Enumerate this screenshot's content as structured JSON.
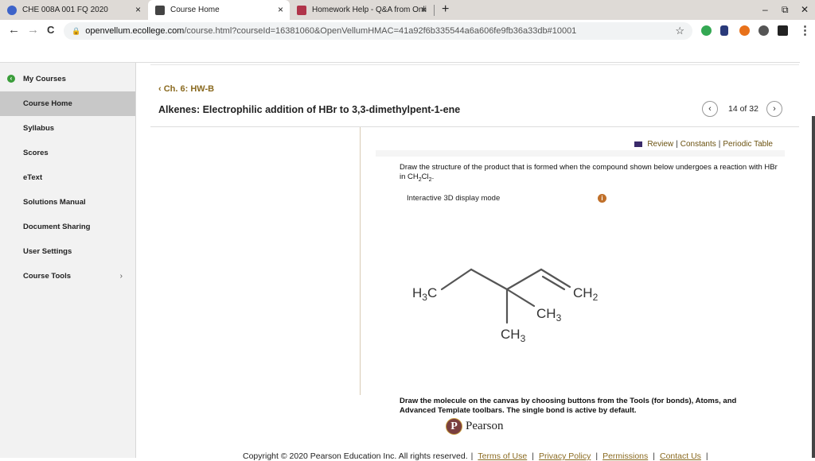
{
  "browser": {
    "tabs": [
      {
        "title": "CHE 008A 001 FQ 2020",
        "active": false,
        "icon": "course-logo-icon"
      },
      {
        "title": "Course Home",
        "active": true,
        "icon": "page-icon"
      },
      {
        "title": "Homework Help - Q&A from Onli",
        "active": false,
        "icon": "chegg-icon"
      }
    ],
    "new_tab": "+",
    "close_glyph": "×",
    "window_controls": {
      "minimize": "–",
      "restore": "⧉",
      "close": "✕"
    },
    "nav": {
      "back": "←",
      "forward": "→",
      "reload": "C"
    },
    "url_host": "openvellum.ecollege.com",
    "url_path": "/course.html?courseId=16381060&OpenVellumHMAC=41a92f6b335544a6a606fe9fb36a33db#10001",
    "star": "☆",
    "menu": "⋮",
    "extension_colors": [
      "#34a853",
      "#2a3a7a",
      "#e8711a",
      "#444444",
      "#222222"
    ]
  },
  "sidebar": {
    "items": [
      {
        "label": "My Courses",
        "back_icon": "‹"
      },
      {
        "label": "Course Home",
        "active": true
      },
      {
        "label": "Syllabus"
      },
      {
        "label": "Scores"
      },
      {
        "label": "eText"
      },
      {
        "label": "Solutions Manual"
      },
      {
        "label": "Document Sharing"
      },
      {
        "label": "User Settings"
      },
      {
        "label": "Course Tools",
        "chevron": "›"
      }
    ]
  },
  "main": {
    "breadcrumb": "Ch. 6: HW-B",
    "breadcrumb_icon": "‹",
    "title": "Alkenes: Electrophilic addition of HBr to 3,3-dimethylpent-1-ene",
    "pager": {
      "prev": "‹",
      "next": "›",
      "text": "14 of 32"
    },
    "resources": {
      "review": "Review",
      "constants": "Constants",
      "periodic": "Periodic Table",
      "sep": "|"
    },
    "question_part1": "Draw the structure of the product that is formed when the compound shown below undergoes a reaction with HBr in CH",
    "question_sub1": "2",
    "question_mid": "Cl",
    "question_sub2": "2",
    "question_end": ".",
    "mode_label": "Interactive 3D display mode",
    "info_icon": "i",
    "molecule": {
      "labels": {
        "h3c": "H",
        "h3c_sub": "3",
        "h3c_c": "C",
        "ch2": "CH",
        "ch2_sub": "2",
        "ch3a": "CH",
        "ch3a_sub": "3",
        "ch3b": "CH",
        "ch3b_sub": "3"
      }
    },
    "instructions": "Draw the molecule on the canvas by choosing buttons from the Tools (for bonds), Atoms, and Advanced Template toolbars. The single bond is active by default.",
    "brand": {
      "logo_letter": "P",
      "name": "Pearson"
    }
  },
  "footer": {
    "copyright": "Copyright © 2020 Pearson Education Inc. All rights reserved.",
    "sep": "|",
    "links": [
      "Terms of Use",
      "Privacy Policy",
      "Permissions",
      "Contact Us"
    ]
  },
  "colors": {
    "accent": "#8a6a20",
    "sidebar_active": "#c8c8c8",
    "back_green": "#3a9d3a"
  }
}
